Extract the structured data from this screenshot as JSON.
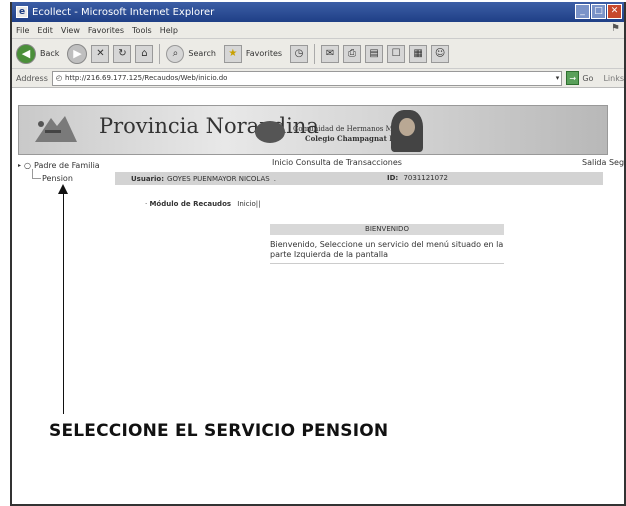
{
  "window": {
    "title": "Ecollect - Microsoft Internet Explorer"
  },
  "menu": {
    "items": [
      "File",
      "Edit",
      "View",
      "Favorites",
      "Tools",
      "Help"
    ]
  },
  "toolbar": {
    "back_label": "Back",
    "search_label": "Search",
    "favorites_label": "Favorites"
  },
  "address": {
    "label": "Address",
    "url": "http://216.69.177.125/Recaudos/Web/inicio.do",
    "go_label": "Go",
    "links_label": "Links"
  },
  "banner": {
    "title": "Provincia Norandina",
    "community": "Comunidad de Hermanos Maristas",
    "school": "Colegio Champagnat Pasto"
  },
  "sidebar": {
    "root_label": "Padre de Familia",
    "child_label": "Pension"
  },
  "topnav": {
    "text": "Inicio  Consulta de Transacciones",
    "logout": "Salida Segura"
  },
  "user": {
    "label": "Usuario:",
    "name": "GOYES PUENMAYOR NICOLAS",
    "id_label": "ID:",
    "id_value": "7031121072"
  },
  "module": {
    "label": "Módulo de Recaudos",
    "crumb": "Inicio||"
  },
  "welcome": {
    "heading": "BIENVENIDO",
    "message": "Bienvenido, Seleccione un servicio del menú situado en la parte Izquierda de la pantalla"
  },
  "annotation": {
    "text": "SELECCIONE EL SERVICIO PENSION"
  }
}
